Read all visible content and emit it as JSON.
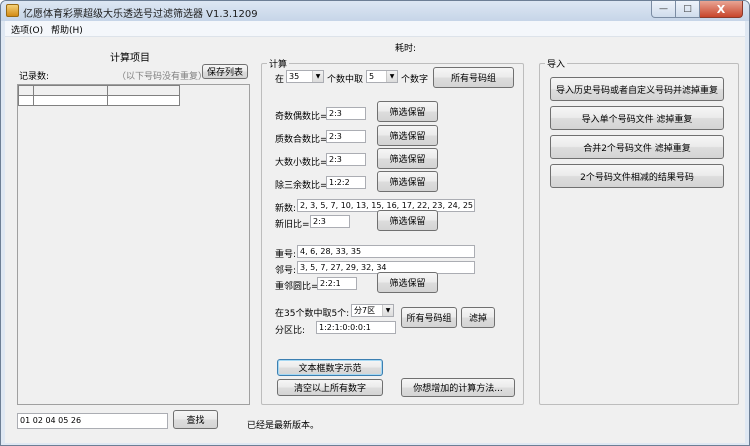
{
  "window": {
    "title": "亿愿体育彩票超级大乐透选号过滤筛选器 V1.3.1209",
    "close_glyph": "X",
    "max_glyph": "□",
    "min_glyph": "—"
  },
  "menu": {
    "options": "选项(O)",
    "help": "帮助(H)"
  },
  "left": {
    "title": "计算项目",
    "record_label": "记录数:",
    "no_dup_note": "（以下号码没有重复）",
    "save_list": "保存列表",
    "search_value": "01 02 04 05 26",
    "search_button": "查找"
  },
  "status": {
    "elapsed_label": "耗时:",
    "version_msg": "已经是最新版本。"
  },
  "calc": {
    "group_title": "计算",
    "pick_prefix": "在",
    "total_value": "35",
    "pick_middle": "个数中取",
    "pick_value": "5",
    "pick_suffix": "个数字",
    "all_combos": "所有号码组",
    "odd_even_label": "奇数偶数比=",
    "odd_even_value": "2:3",
    "prime_comp_label": "质数合数比=",
    "prime_comp_value": "2:3",
    "big_small_label": "大数小数比=",
    "big_small_value": "2:3",
    "mod3_label": "除三余数比=",
    "mod3_value": "1:2:2",
    "filter_keep": "筛选保留",
    "new_label": "新数:",
    "new_value": "2, 3, 5, 7, 10, 13, 15, 16, 17, 22, 23, 24, 25",
    "new_old_label": "新旧比=",
    "new_old_value": "2:3",
    "repeat_label": "重号:",
    "repeat_value": "4, 6, 28, 33, 35",
    "adjacent_label": "邻号:",
    "adjacent_value": "3, 5, 7, 27, 29, 32, 34",
    "rep_adj_label": "重邻圆比=",
    "rep_adj_value": "2:2:1",
    "zone_prefix": "在35个数中取5个:",
    "zone_select": "分7区",
    "zone_ratio_label": "分区比:",
    "zone_ratio_value": "1:2:1:0:0:0:1",
    "zone_all": "所有号码组",
    "zone_filter": "滤掉",
    "demo_button": "文本框数字示范",
    "clear_button": "清空以上所有数字",
    "add_method_button": "你想增加的计算方法..."
  },
  "import": {
    "group_title": "导入",
    "btn1": "导入历史号码或者自定义号码并滤掉重复",
    "btn2": "导入单个号码文件 滤掉重复",
    "btn3": "合并2个号码文件 滤掉重复",
    "btn4": "2个号码文件相减的结果号码"
  },
  "colors": {
    "title_bar": "#c6d5e8",
    "close_button": "#c8452b",
    "client_bg": "#f0f0f0",
    "focus_border": "#3c7fb1"
  },
  "icons": {
    "app": "lottery-app-icon",
    "dropdown": "dropdown-arrow-icon"
  }
}
